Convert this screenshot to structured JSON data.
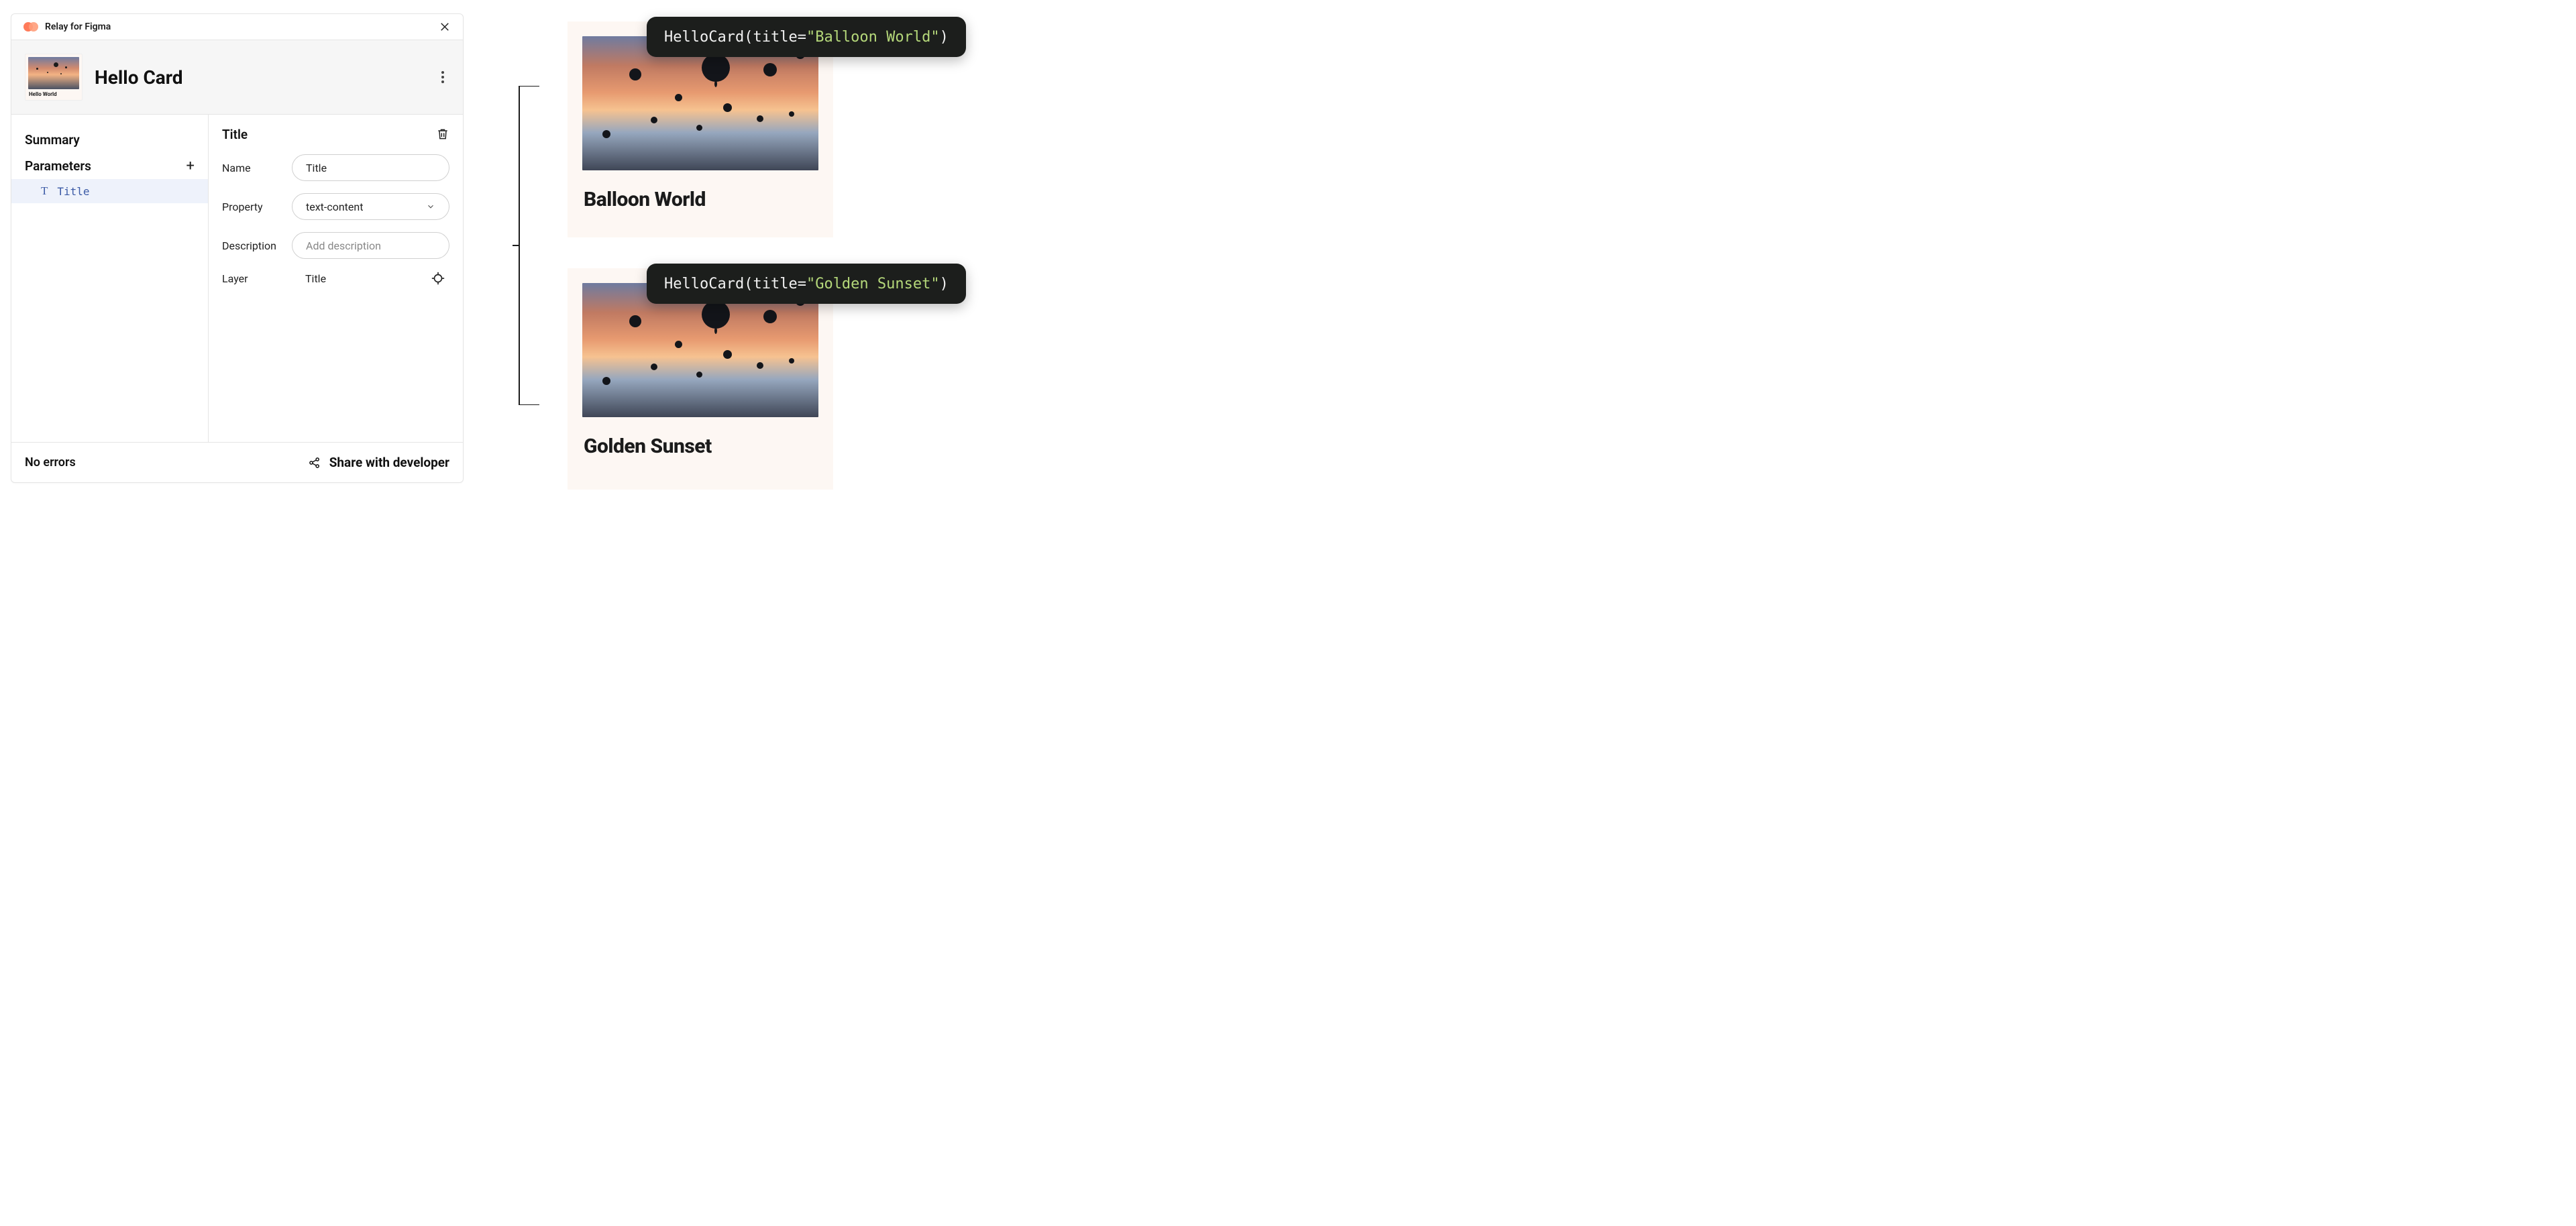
{
  "plugin": {
    "name": "Relay for Figma"
  },
  "component": {
    "title": "Hello Card",
    "thumbnail_caption": "Hello World"
  },
  "sidebar": {
    "summary_label": "Summary",
    "parameters_label": "Parameters",
    "parameters": [
      {
        "name": "Title"
      }
    ]
  },
  "detail": {
    "heading": "Title",
    "fields": {
      "name": {
        "label": "Name",
        "value": "Title"
      },
      "property": {
        "label": "Property",
        "value": "text-content"
      },
      "description": {
        "label": "Description",
        "placeholder": "Add description",
        "value": ""
      },
      "layer": {
        "label": "Layer",
        "value": "Title"
      }
    }
  },
  "footer": {
    "status": "No errors",
    "share_label": "Share with developer"
  },
  "preview": {
    "cards": [
      {
        "title": "Balloon World",
        "code": {
          "fn": "HelloCard",
          "argName": "title",
          "argValue": "\"Balloon World\""
        }
      },
      {
        "title": "Golden Sunset",
        "code": {
          "fn": "HelloCard",
          "argName": "title",
          "argValue": "\"Golden Sunset\""
        }
      }
    ]
  }
}
